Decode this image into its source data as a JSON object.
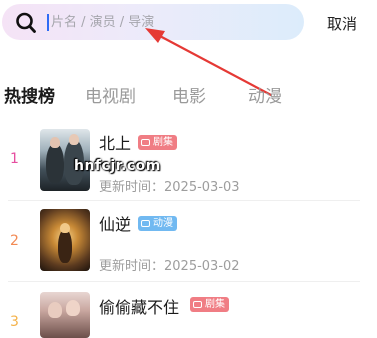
{
  "search": {
    "placeholder": "片名 / 演员 / 导演",
    "value": "",
    "cancel_label": "取消"
  },
  "tabs": [
    {
      "label": "热搜榜",
      "active": true
    },
    {
      "label": "电视剧",
      "active": false
    },
    {
      "label": "电影",
      "active": false
    },
    {
      "label": "动漫",
      "active": false
    }
  ],
  "items": [
    {
      "rank": "1",
      "title": "北上",
      "badge": "剧集",
      "update": "更新时间：2025-03-03",
      "rank_color": "#e64ea0",
      "badge_color": "#f07d84"
    },
    {
      "rank": "2",
      "title": "仙逆",
      "badge": "动漫",
      "update": "更新时间：2025-03-02",
      "rank_color": "#f28a54",
      "badge_color": "#71b9f1"
    },
    {
      "rank": "3",
      "title": "偷偷藏不住",
      "badge": "剧集",
      "update": "",
      "rank_color": "#f4b24a",
      "badge_color": "#f07d84"
    }
  ],
  "watermark": "hnfcjr.com",
  "colors": {
    "accent": "#2f6cf5",
    "arrow": "#e53935"
  }
}
